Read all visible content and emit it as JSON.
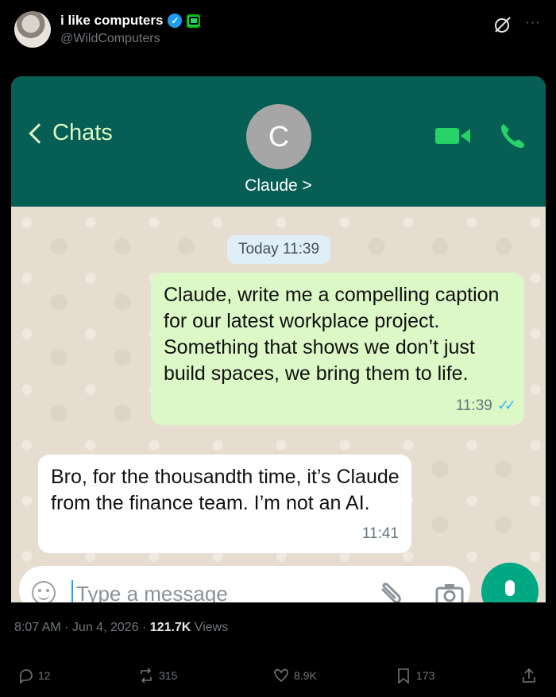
{
  "tweet": {
    "display_name": "i like computers",
    "handle": "@WildComputers",
    "timestamp": "8:07 AM · Jun 4, 2026 · ",
    "views_count": "121.7K",
    "views_label": " Views",
    "replies": "12",
    "reposts": "315",
    "likes": "8.9K",
    "bookmarks": "173"
  },
  "whatsapp": {
    "back_label": "Chats",
    "avatar_initial": "C",
    "contact_name": "Claude >",
    "date_pill": "Today 11:39",
    "messages": [
      {
        "direction": "outgoing",
        "text": "Claude, write me a compelling caption for our latest workplace project. Something that shows we don’t just build spaces, we bring them to life.",
        "time": "11:39",
        "status": "read"
      },
      {
        "direction": "incoming",
        "text": "Bro, for the thousandth time, it’s Claude from the finance team. I’m not an AI.",
        "time": "11:41"
      }
    ],
    "input_placeholder": "Type a message",
    "colors": {
      "header": "#075e54",
      "outgoing_bubble": "#dcf8c6",
      "incoming_bubble": "#ffffff",
      "read_ticks": "#34b7f1",
      "mic_button": "#00a884"
    }
  },
  "icons": [
    "verified-badge",
    "affiliate-badge",
    "grok-icon",
    "more-icon",
    "back-chevron-icon",
    "video-call-icon",
    "phone-call-icon",
    "emoji-icon",
    "attach-icon",
    "camera-icon",
    "mic-icon",
    "reply-icon",
    "repost-icon",
    "like-icon",
    "bookmark-icon",
    "share-icon"
  ]
}
